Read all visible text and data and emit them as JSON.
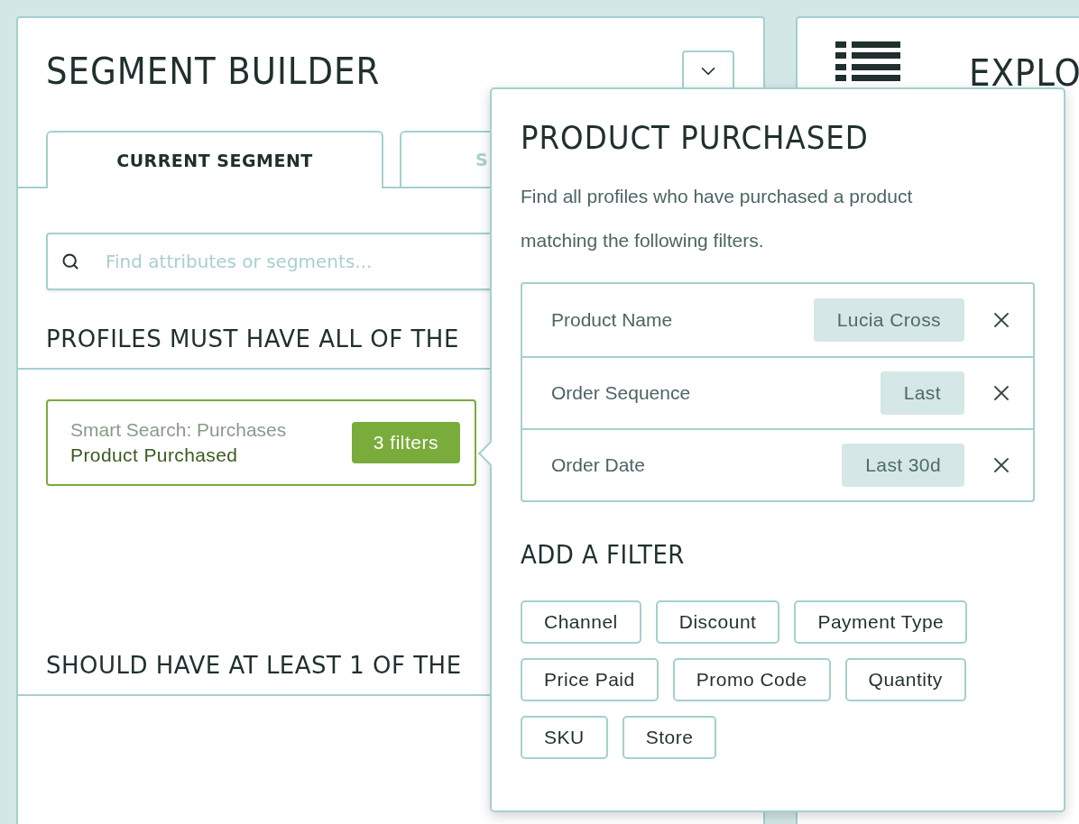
{
  "segment_builder": {
    "title": "SEGMENT BUILDER",
    "tabs": [
      {
        "label": "CURRENT SEGMENT",
        "selected": true
      },
      {
        "label": "S",
        "selected": false
      }
    ],
    "search": {
      "placeholder": "Find attributes or segments..."
    },
    "sections": [
      {
        "heading": "PROFILES MUST HAVE ALL OF THE",
        "conditions": [
          {
            "source": "Smart Search: Purchases",
            "name": "Product Purchased",
            "badge": "3 filters"
          }
        ]
      },
      {
        "heading": "SHOULD HAVE AT LEAST 1 OF THE"
      }
    ]
  },
  "explorer": {
    "title": "EXPLO"
  },
  "popover": {
    "title": "PRODUCT PURCHASED",
    "description": "Find all profiles who have purchased a product matching the following filters.",
    "filters": [
      {
        "label": "Product Name",
        "value": "Lucia Cross"
      },
      {
        "label": "Order Sequence",
        "value": "Last"
      },
      {
        "label": "Order Date",
        "value": "Last 30d"
      }
    ],
    "add_heading": "ADD A FILTER",
    "add_options": [
      "Channel",
      "Discount",
      "Payment Type",
      "Price Paid",
      "Promo Code",
      "Quantity",
      "SKU",
      "Store"
    ]
  }
}
